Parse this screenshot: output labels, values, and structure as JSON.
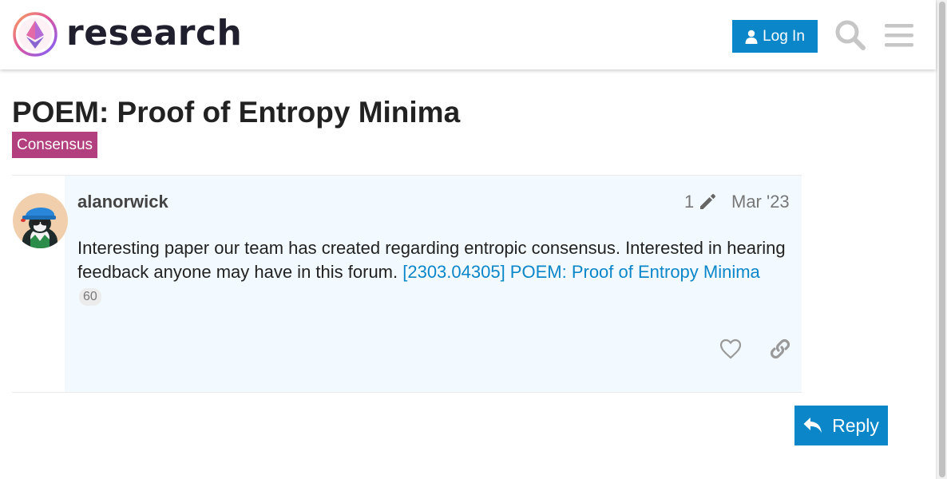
{
  "header": {
    "logo_text": "research",
    "login_label": "Log In",
    "icons": [
      "user-icon",
      "search-icon",
      "hamburger-menu-icon"
    ]
  },
  "topic": {
    "title": "POEM: Proof of Entropy Minima",
    "category": "Consensus",
    "category_color": "#b3407e"
  },
  "post": {
    "username": "alanorwick",
    "edit_count": "1",
    "date": "Mar '23",
    "body_text": "Interesting paper our team has created regarding entropic consensus. Interested in hearing feedback anyone may have in this forum. ",
    "link_text": "[2303.04305] POEM: Proof of Entropy Minima",
    "link_clicks": "60",
    "actions": [
      "heart-icon",
      "link-icon"
    ]
  },
  "reply_label": "Reply",
  "colors": {
    "accent": "#0a86c9",
    "post_background": "#f3faff"
  }
}
